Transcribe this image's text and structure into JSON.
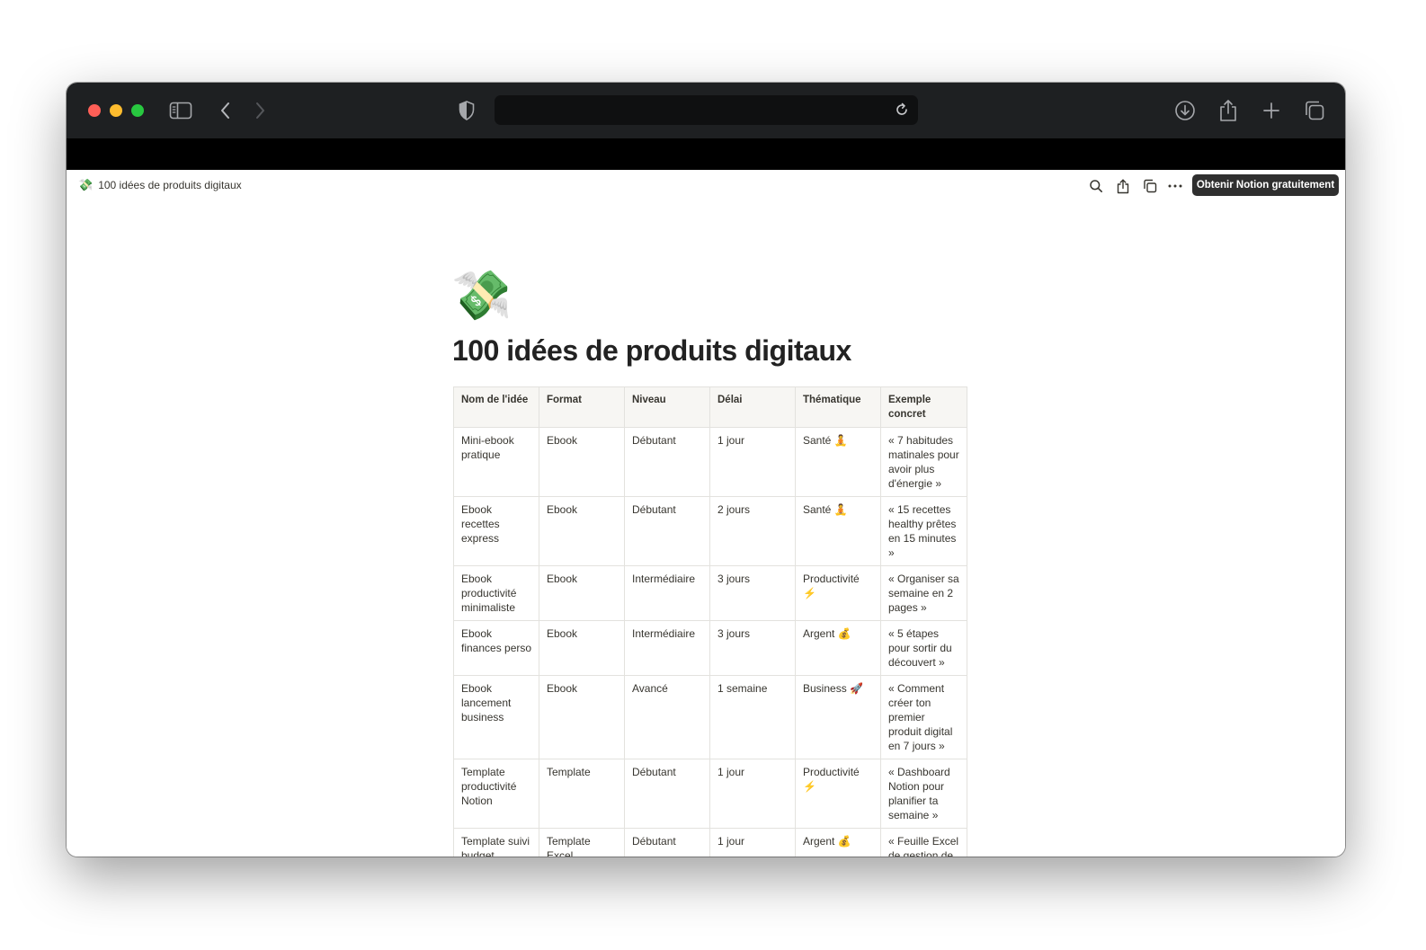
{
  "page_title_bar": {
    "emoji": "💸",
    "title": "100 idées de produits digitaux"
  },
  "header": {
    "cta": "Obtenir Notion gratuitement"
  },
  "page": {
    "emoji": "💸",
    "title": "100 idées de produits digitaux"
  },
  "table": {
    "headers": [
      "Nom de l'idée",
      "Format",
      "Niveau",
      "Délai",
      "Thématique",
      "Exemple concret"
    ],
    "rows": [
      [
        "Mini-ebook pratique",
        "Ebook",
        "Débutant",
        "1 jour",
        "Santé 🧘",
        "« 7 habitudes matinales pour avoir plus d'énergie »"
      ],
      [
        "Ebook recettes express",
        "Ebook",
        "Débutant",
        "2 jours",
        "Santé 🧘",
        "« 15 recettes healthy prêtes en 15 minutes »"
      ],
      [
        "Ebook productivité minimaliste",
        "Ebook",
        "Intermédiaire",
        "3 jours",
        "Productivité ⚡",
        "« Organiser sa semaine en 2 pages »"
      ],
      [
        "Ebook finances perso",
        "Ebook",
        "Intermédiaire",
        "3 jours",
        "Argent 💰",
        "« 5 étapes pour sortir du découvert »"
      ],
      [
        "Ebook lancement business",
        "Ebook",
        "Avancé",
        "1 semaine",
        "Business 🚀",
        "« Comment créer ton premier produit digital en 7 jours »"
      ],
      [
        "Template productivité Notion",
        "Template",
        "Débutant",
        "1 jour",
        "Productivité ⚡",
        "« Dashboard Notion pour planifier ta semaine »"
      ],
      [
        "Template suivi budget",
        "Template Excel",
        "Débutant",
        "1 jour",
        "Argent 💰",
        "« Feuille Excel de gestion de budget familial »"
      ]
    ]
  },
  "colors": {
    "toolbar_bg": "#1e2022",
    "traffic_red": "#fe5f57",
    "traffic_yellow": "#febc2e",
    "traffic_green": "#28c840",
    "cta_bg": "#2f2f2f",
    "header_row_bg": "#f7f6f3",
    "table_border": "#e3e2de"
  },
  "icons": {
    "toolbar": [
      "sidebar-icon",
      "back-icon",
      "forward-icon",
      "privacy-shield-icon",
      "reload-icon",
      "download-icon",
      "share-icon",
      "new-tab-icon",
      "tab-overview-icon"
    ],
    "notion_topbar": [
      "search-icon",
      "share-icon",
      "duplicate-icon",
      "more-icon"
    ]
  }
}
